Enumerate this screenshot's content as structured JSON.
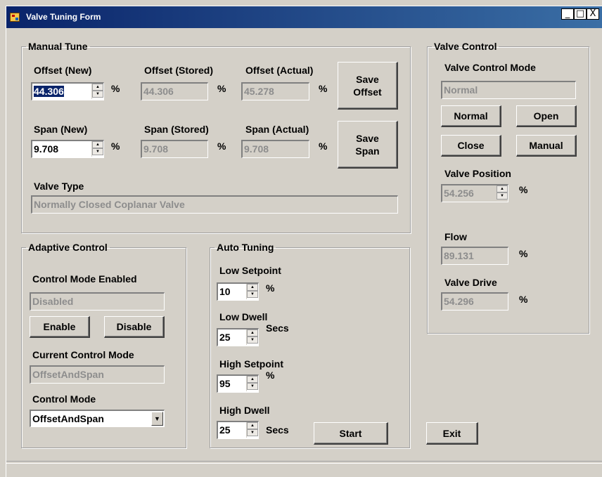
{
  "window": {
    "title": "Valve Tuning Form",
    "min_glyph": "_",
    "max_glyph": "□",
    "close_glyph": "X"
  },
  "manual_tune": {
    "legend": "Manual Tune",
    "offset_new_label": "Offset (New)",
    "offset_new_value": "44.306",
    "offset_stored_label": "Offset (Stored)",
    "offset_stored_value": "44.306",
    "offset_actual_label": "Offset (Actual)",
    "offset_actual_value": "45.278",
    "span_new_label": "Span (New)",
    "span_new_value": "9.708",
    "span_stored_label": "Span (Stored)",
    "span_stored_value": "9.708",
    "span_actual_label": "Span (Actual)",
    "span_actual_value": "9.708",
    "unit": "%",
    "save_offset_label": "Save Offset",
    "save_span_label": "Save Span",
    "valve_type_label": "Valve Type",
    "valve_type_value": "Normally Closed Coplanar Valve"
  },
  "valve_control": {
    "legend": "Valve Control",
    "mode_label": "Valve Control Mode",
    "mode_value": "Normal",
    "normal_label": "Normal",
    "open_label": "Open",
    "close_label": "Close",
    "manual_label": "Manual",
    "position_label": "Valve Position",
    "position_value": "54.256",
    "flow_label": "Flow",
    "flow_value": "89.131",
    "drive_label": "Valve Drive",
    "drive_value": "54.296",
    "unit": "%"
  },
  "adaptive_control": {
    "legend": "Adaptive Control",
    "enabled_label": "Control Mode Enabled",
    "enabled_value": "Disabled",
    "enable_label": "Enable",
    "disable_label": "Disable",
    "current_label": "Current Control Mode",
    "current_value": "OffsetAndSpan",
    "mode_label": "Control Mode",
    "mode_selected": "OffsetAndSpan"
  },
  "auto_tuning": {
    "legend": "Auto Tuning",
    "low_setpoint_label": "Low Setpoint",
    "low_setpoint_value": "10",
    "low_setpoint_unit": "%",
    "low_dwell_label": "Low Dwell",
    "low_dwell_value": "25",
    "low_dwell_unit": "Secs",
    "high_setpoint_label": "High Setpoint",
    "high_setpoint_value": "95",
    "high_setpoint_unit": "%",
    "high_dwell_label": "High Dwell",
    "high_dwell_value": "25",
    "high_dwell_unit": "Secs",
    "start_label": "Start"
  },
  "exit_label": "Exit",
  "icons": {
    "spin_up": "▲",
    "spin_down": "▼",
    "dropdown": "▼"
  }
}
